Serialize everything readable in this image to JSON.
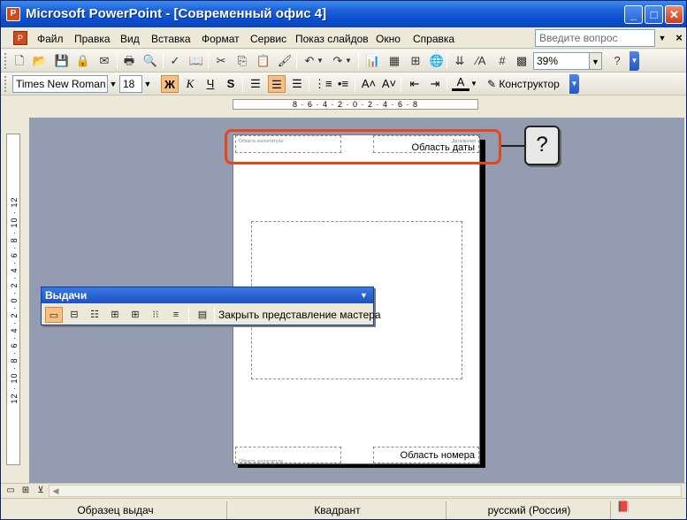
{
  "window": {
    "title": "Microsoft PowerPoint - [Современный офис 4]"
  },
  "menubar": {
    "items": [
      "Файл",
      "Правка",
      "Вид",
      "Вставка",
      "Формат",
      "Сервис",
      "Показ слайдов",
      "Окно",
      "Справка"
    ],
    "ask_placeholder": "Введите вопрос"
  },
  "toolbar_standard": {
    "zoom": "39%"
  },
  "toolbar_formatting": {
    "font_name": "Times New Roman",
    "font_size": "18",
    "bold_label": "Ж",
    "italic_label": "К",
    "underline_label": "Ч",
    "shadow_label": "S",
    "designer_label": "Конструктор"
  },
  "rulers": {
    "horizontal": "8 · 6 · 4 · 2 · 0 · 2 · 4 · 6 · 8",
    "vertical": "12 · 10 · 8 · 6 · 4 · 2 · 0 · 2 · 4 · 6 · 8 · 10 · 12"
  },
  "handout_page": {
    "header_label": "Область колонтитула",
    "date_small": "Дата/время",
    "date_label": "Область даты",
    "footer_label": "Область колонтитула",
    "number_label": "Область номера"
  },
  "callout": {
    "text": "?"
  },
  "handout_toolbar": {
    "title": "Выдачи",
    "close_label": "Закрыть представление мастера"
  },
  "statusbar": {
    "view_name": "Образец выдач",
    "design": "Квадрант",
    "language": "русский (Россия)"
  },
  "colors": {
    "highlight": "#e5461b",
    "workspace": "#939cb1",
    "titlebar": "#0a4fd0"
  }
}
